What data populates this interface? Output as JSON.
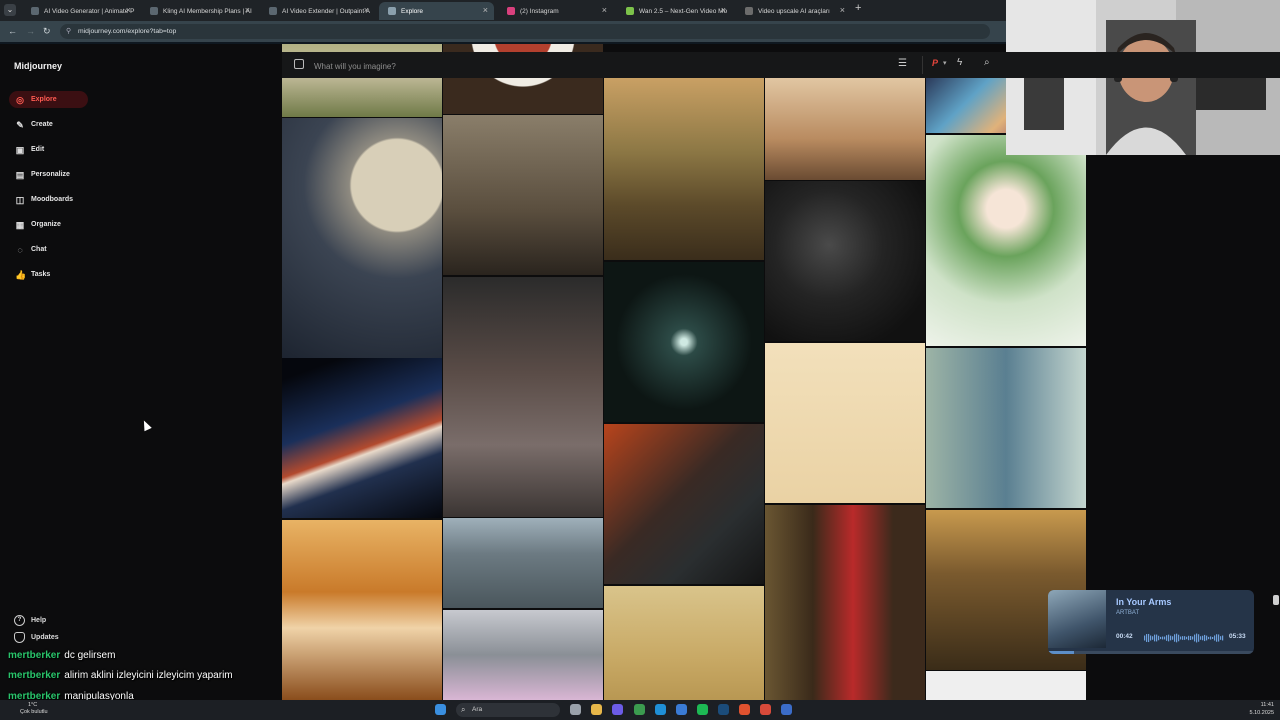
{
  "browser": {
    "tabs": [
      {
        "title": "AI Video Generator | Animate P",
        "color": "#5b6770"
      },
      {
        "title": "Kling AI Membership Plans | AI",
        "color": "#5b6770"
      },
      {
        "title": "AI Video Extender | Outpaint A",
        "color": "#5b6770"
      },
      {
        "title": "Explore",
        "color": "#8aa0ad"
      },
      {
        "title": "(2) Instagram",
        "color": "#d9407d"
      },
      {
        "title": "Wan 2.5 – Next-Gen Video Mo",
        "color": "#7cc24a"
      },
      {
        "title": "Video upscale AI araçları",
        "color": "#6c6c6c"
      }
    ],
    "new_tab_icon": "+",
    "url": "midjourney.com/explore?tab=top"
  },
  "sidebar": {
    "brand": "Midjourney",
    "items": [
      {
        "label": "Explore",
        "icon": "compass-icon",
        "glyph": "◎",
        "active": true
      },
      {
        "label": "Create",
        "icon": "brush-icon",
        "glyph": "✎",
        "active": false
      },
      {
        "label": "Edit",
        "icon": "edit-icon",
        "glyph": "▣",
        "active": false
      },
      {
        "label": "Personalize",
        "icon": "sliders-icon",
        "glyph": "▤",
        "active": false
      },
      {
        "label": "Moodboards",
        "icon": "moodboard-icon",
        "glyph": "◫",
        "active": false
      },
      {
        "label": "Organize",
        "icon": "grid-icon",
        "glyph": "▦",
        "active": false
      },
      {
        "label": "Chat",
        "icon": "chat-icon",
        "glyph": "◌",
        "active": false
      },
      {
        "label": "Tasks",
        "icon": "thumbs-up-icon",
        "glyph": "👍",
        "active": false
      }
    ],
    "bottom": [
      {
        "label": "Help",
        "icon": "help-icon"
      },
      {
        "label": "Updates",
        "icon": "bell-icon"
      }
    ]
  },
  "search": {
    "placeholder": "What will you imagine?",
    "icons": [
      "image-icon",
      "filter-icon",
      "personalize-p-icon",
      "bolt-icon",
      "search-icon"
    ]
  },
  "gallery": {
    "tiles": [
      {
        "name": "tile-sheep-feet",
        "bg": "linear-gradient(180deg,#8f9a5a,#c8c0a0 60%,#6f7a47)"
      },
      {
        "name": "tile-cat-moon",
        "bg": "radial-gradient(circle at 72% 28%,#d8cfb8 0 22%,#8e8a80 23%,#3b4452 45%,#1d2430 100%)"
      },
      {
        "name": "tile-fireworks",
        "bg": "linear-gradient(160deg,#05070d 10%,#1a2f5a 40%,#b34a2e 55%,#e8d9c9 58%,#21304e 70%,#05070d)"
      },
      {
        "name": "tile-pumpkins",
        "bg": "linear-gradient(180deg,#e8b365,#c97a2a 40%,#f0d3a8 60%,#8a4d1c)"
      },
      {
        "name": "tile-salad-plate",
        "bg": "radial-gradient(ellipse at 50% 30%,#b3402e 0 25%,#f0ece4 26% 45%,#3a2a1e 46%)"
      },
      {
        "name": "tile-frames-room",
        "bg": "linear-gradient(180deg,#8a7e6a,#5a4e3e 60%,#2a241e)"
      },
      {
        "name": "tile-hooded-figure",
        "bg": "linear-gradient(180deg,#2b2b2b,#5a4c47 40%,#7a6d6a 70%,#3b3533)"
      },
      {
        "name": "tile-helmet-rider",
        "bg": "linear-gradient(180deg,#9fb0ba,#6c7a82 40%,#4a565c)"
      },
      {
        "name": "tile-glass-scene",
        "bg": "linear-gradient(180deg,#c7c9cf,#8a8f96 50%,#d9b6d4)"
      },
      {
        "name": "tile-valley-window",
        "bg": "linear-gradient(180deg,#c9a064,#8d7845 40%,#5c4a2a 70%,#3a2d1b)"
      },
      {
        "name": "tile-glowing-door",
        "bg": "radial-gradient(circle at 50% 50%,#cfe9e2 0 3%,#2c4a46 12%,#0d1614 60%)"
      },
      {
        "name": "tile-shouting-man",
        "bg": "linear-gradient(135deg,#b8441c,#3a2a24 45%,#2a2e30 70%,#141414)"
      },
      {
        "name": "tile-sketch-portrait",
        "bg": "linear-gradient(180deg,#d9c48b,#c8a965 60%,#b69550)"
      },
      {
        "name": "tile-desk-room",
        "bg": "linear-gradient(180deg,#e1c6a2,#b98b60 60%,#6a4b32)"
      },
      {
        "name": "tile-dark-flowers",
        "bg": "radial-gradient(circle at 40% 40%,#4a4a4a,#242424 40%,#111 80%)"
      },
      {
        "name": "tile-ghost-dog",
        "bg": "linear-gradient(180deg,#f2e0bb,#ead2a4)"
      },
      {
        "name": "tile-red-dress-woman",
        "bg": "linear-gradient(90deg,#6a5632,#3a2a1a 30%,#b92a2a 55%,#3c2a1c 80%)"
      },
      {
        "name": "tile-marble-swirl",
        "bg": "linear-gradient(135deg,#2b3a5a,#5fa2c6 30%,#e0b27a 55%,#8a4a6a 80%)"
      },
      {
        "name": "tile-green-doll",
        "bg": "radial-gradient(circle at 50% 35%,#f6e5d7 0 12%,#6aa35c 30%,#cfe2c8 60%,#eef3ea)"
      },
      {
        "name": "tile-cartoon-men",
        "bg": "linear-gradient(90deg,#9db4a6,#5a7f91 50%,#c4d6cf)"
      },
      {
        "name": "tile-monk-forest",
        "bg": "linear-gradient(180deg,#c89a4e,#7a5a2e 40%,#3a2c18)"
      },
      {
        "name": "tile-white-bottom",
        "bg": "#efefef"
      }
    ]
  },
  "webcam": {
    "label": "streamer webcam"
  },
  "music": {
    "title": "In Your Arms",
    "artist": "ARTBAT",
    "elapsed": "00:42",
    "duration": "05:33",
    "progress_fraction": 0.126
  },
  "chat": [
    {
      "user": "mertberker",
      "message": "dc gelirsem"
    },
    {
      "user": "mertberker",
      "message": "alirim aklini izleyicini izleyicim yaparim"
    },
    {
      "user": "mertberker",
      "message": "manipulasyonla"
    }
  ],
  "taskbar": {
    "search_label": "Ara",
    "weather_temp": "1°C",
    "weather_text": "Çok bulutlu",
    "time": "11:41",
    "date": "5.10.2025",
    "icons": [
      {
        "name": "windows-start-icon",
        "color": "#3a8fe0"
      },
      {
        "name": "task-view-icon",
        "color": "#9aa1aa"
      },
      {
        "name": "file-explorer-icon",
        "color": "#e7b74a"
      },
      {
        "name": "copilot-icon",
        "color": "#6c5ce7"
      },
      {
        "name": "chrome-icon",
        "color": "#3b9b4f"
      },
      {
        "name": "edge-icon",
        "color": "#1f8fd6"
      },
      {
        "name": "store-icon",
        "color": "#3a7bd5"
      },
      {
        "name": "spotify-icon",
        "color": "#1db954"
      },
      {
        "name": "steam-icon",
        "color": "#1b4c7a"
      },
      {
        "name": "browser-icon",
        "color": "#e0522f"
      },
      {
        "name": "chrome-alt-icon",
        "color": "#d84a3a"
      },
      {
        "name": "gear-app-icon",
        "color": "#3b6cc8"
      }
    ]
  }
}
